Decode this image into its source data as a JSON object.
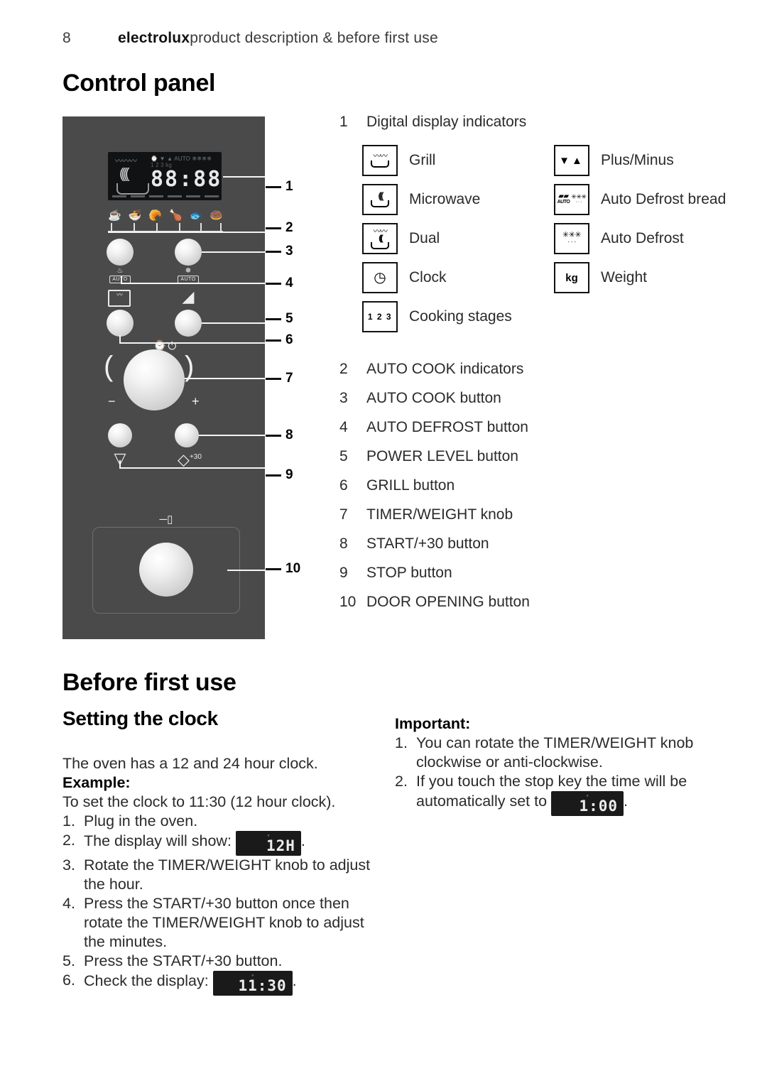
{
  "header": {
    "page_number": "8",
    "brand": "electrolux",
    "section": "product description & before first use"
  },
  "headings": {
    "control_panel": "Control panel",
    "before_first_use": "Before first use",
    "setting_the_clock": "Setting the clock"
  },
  "control_panel_art": {
    "lcd": {
      "digits": "88:88",
      "indicator_row_1": "⌚ ▼ ▲   AUTO   ❄❄❄❄",
      "indicator_row_2": "1  2  3            kg"
    },
    "auto_cook_icons": [
      "☕",
      "🍜",
      "🥐",
      "🍗",
      "🐟",
      "🍩"
    ],
    "button_symbols": {
      "auto_cook": "♨",
      "auto_cook_label": "AUTO",
      "auto_defrost": "❅",
      "auto_defrost_label": "AUTO",
      "grill": "〰",
      "power_level": "◢",
      "clock": "⌚",
      "door_indicator": "⏻",
      "stop": "▽",
      "start": "◇",
      "start_plus": "+30",
      "key": "─▯",
      "minus": "−",
      "plus": "+",
      "arc_left": "⟲",
      "arc_right": "⟳"
    },
    "callout_numbers": [
      "1",
      "2",
      "3",
      "4",
      "5",
      "6",
      "7",
      "8",
      "9",
      "10"
    ]
  },
  "legend": {
    "item1": {
      "number": "1",
      "text": "Digital display indicators"
    },
    "indicators": [
      {
        "icon": "grill-indicator-icon",
        "glyph": "〰",
        "label": "Grill"
      },
      {
        "icon": "microwave-indicator-icon",
        "glyph": "((((",
        "label": "Microwave"
      },
      {
        "icon": "dual-indicator-icon",
        "glyph": "〰",
        "label": "Dual"
      },
      {
        "icon": "clock-indicator-icon",
        "glyph": "⊙",
        "label": "Clock"
      },
      {
        "icon": "cooking-stages-indicator-icon",
        "glyph": "1 2 3",
        "label": "Cooking stages"
      },
      {
        "icon": "plus-minus-indicator-icon",
        "glyph": "▼▲",
        "label": "Plus/Minus"
      },
      {
        "icon": "auto-defrost-bread-indicator-icon",
        "glyph": "AUTO",
        "label": "Auto Defrost bread"
      },
      {
        "icon": "auto-defrost-indicator-icon",
        "glyph": "❅",
        "label": "Auto Defrost"
      },
      {
        "icon": "weight-indicator-icon",
        "glyph": "kg",
        "label": "Weight"
      }
    ],
    "parts": [
      {
        "number": "2",
        "text": "AUTO COOK indicators"
      },
      {
        "number": "3",
        "text": "AUTO COOK button"
      },
      {
        "number": "4",
        "text": "AUTO DEFROST button"
      },
      {
        "number": "5",
        "text": "POWER LEVEL button"
      },
      {
        "number": "6",
        "text": "GRILL button"
      },
      {
        "number": "7",
        "text": "TIMER/WEIGHT knob"
      },
      {
        "number": "8",
        "text": "START/+30 button"
      },
      {
        "number": "9",
        "text": "STOP button"
      },
      {
        "number": "10",
        "text": "DOOR OPENING button"
      }
    ]
  },
  "setting_clock": {
    "intro": "The oven has a 12 and 24 hour clock.",
    "example_label": "Example:",
    "example_intro": "To set the clock to 11:30 (12 hour clock).",
    "steps": [
      {
        "marker": "1.",
        "text": "Plug in the oven."
      },
      {
        "marker": "2.",
        "text": "The display will show:",
        "display": "12H",
        "tail": "."
      },
      {
        "marker": "3.",
        "text": "Rotate the TIMER/WEIGHT knob to adjust the hour."
      },
      {
        "marker": "4.",
        "text": "Press the START/+30 button once then rotate the TIMER/WEIGHT knob to adjust the minutes."
      },
      {
        "marker": "5.",
        "text": "Press the START/+30 button."
      },
      {
        "marker": "6.",
        "text": "Check the display:",
        "display": "11:30",
        "tail": "."
      }
    ]
  },
  "important": {
    "label": "Important:",
    "items": [
      {
        "marker": "1.",
        "text": "You can rotate the TIMER/WEIGHT knob clockwise or anti-clockwise."
      },
      {
        "marker": "2.",
        "text": "If you touch the stop key the time will be automatically set to",
        "display": "1:00",
        "tail": "."
      }
    ]
  },
  "colors": {
    "panel_background": "#4a4a4a",
    "lcd_background": "#111214",
    "text": "#2a2a2a",
    "heading": "#000000"
  }
}
